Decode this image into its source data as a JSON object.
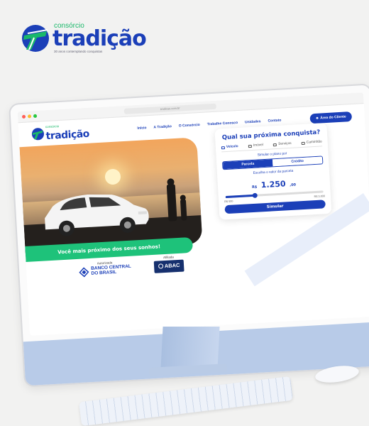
{
  "brand": {
    "small": "consórcio",
    "name": "tradição",
    "tagline": "30 anos contemplando conquistas"
  },
  "browser": {
    "url": "tradicao.com.br"
  },
  "site": {
    "logo_small": "consórcio",
    "logo_name": "tradição",
    "nav": [
      "Início",
      "A Tradição",
      "O Consórcio",
      "Trabalhe Conosco",
      "Unidades",
      "Contato"
    ],
    "client_button": "Área do Cliente",
    "hero_banner": "Você mais próximo dos seus sonhos!",
    "simulator": {
      "title": "Qual sua próxima conquista?",
      "tabs": [
        "Veículo",
        "Imóvel",
        "Serviços",
        "Caminhão"
      ],
      "active_tab": "Veículo",
      "simulate_by_label": "Simular o plano por",
      "options": [
        "Parcela",
        "Crédito"
      ],
      "selected_option": "Parcela",
      "choose_label": "Escolha o valor da parcela",
      "currency": "R$",
      "amount_whole": "1.250",
      "amount_cents": ",00",
      "slider_min": "R$ 500",
      "slider_max": "R$ 3.000",
      "slider_fraction": 0.3,
      "button": "Simular"
    },
    "footer": {
      "authorized_label": "Autorizada",
      "bcb_line1": "BANCO CENTRAL",
      "bcb_line2": "DO BRASIL",
      "affiliated_label": "Afiliada",
      "abac_name": "ABAC"
    }
  },
  "colors": {
    "brand_blue": "#1b3fb8",
    "brand_green": "#1ab86a",
    "background": "#f2f2f1"
  }
}
